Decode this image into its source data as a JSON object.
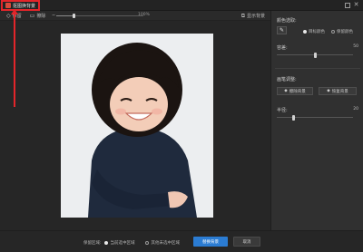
{
  "window": {
    "title": "抠图换背景",
    "close_glyph": "✕",
    "maximize_glyph": ""
  },
  "toolbar": {
    "keep_label": "保留",
    "erase_label": "擦除",
    "zoom_value": "100%",
    "zoom_fraction": 0.2,
    "background_toggle_label": "显示背景"
  },
  "right_panel": {
    "pick_color_title": "颜色选取:",
    "target_color_label": "目标颜色",
    "keep_color_label": "保留颜色",
    "tolerance_label": "容差:",
    "tolerance_value": "50",
    "tolerance_fraction": 0.5,
    "brush_title": "画笔调整:",
    "erase_bg_label": "擦除背景",
    "restore_bg_label": "恢复背景",
    "brush_size_label": "半径:",
    "brush_size_value": "20",
    "brush_size_fraction": 0.22
  },
  "bottom": {
    "keep_area_label": "保留区域:",
    "option_selected_label": "当前选中区域",
    "option_other_label": "其他未选中区域",
    "replace_bg_button": "替换背景",
    "cancel_button": "取消"
  },
  "colors": {
    "accent": "#2b7cd3",
    "highlight": "#e3252a"
  }
}
